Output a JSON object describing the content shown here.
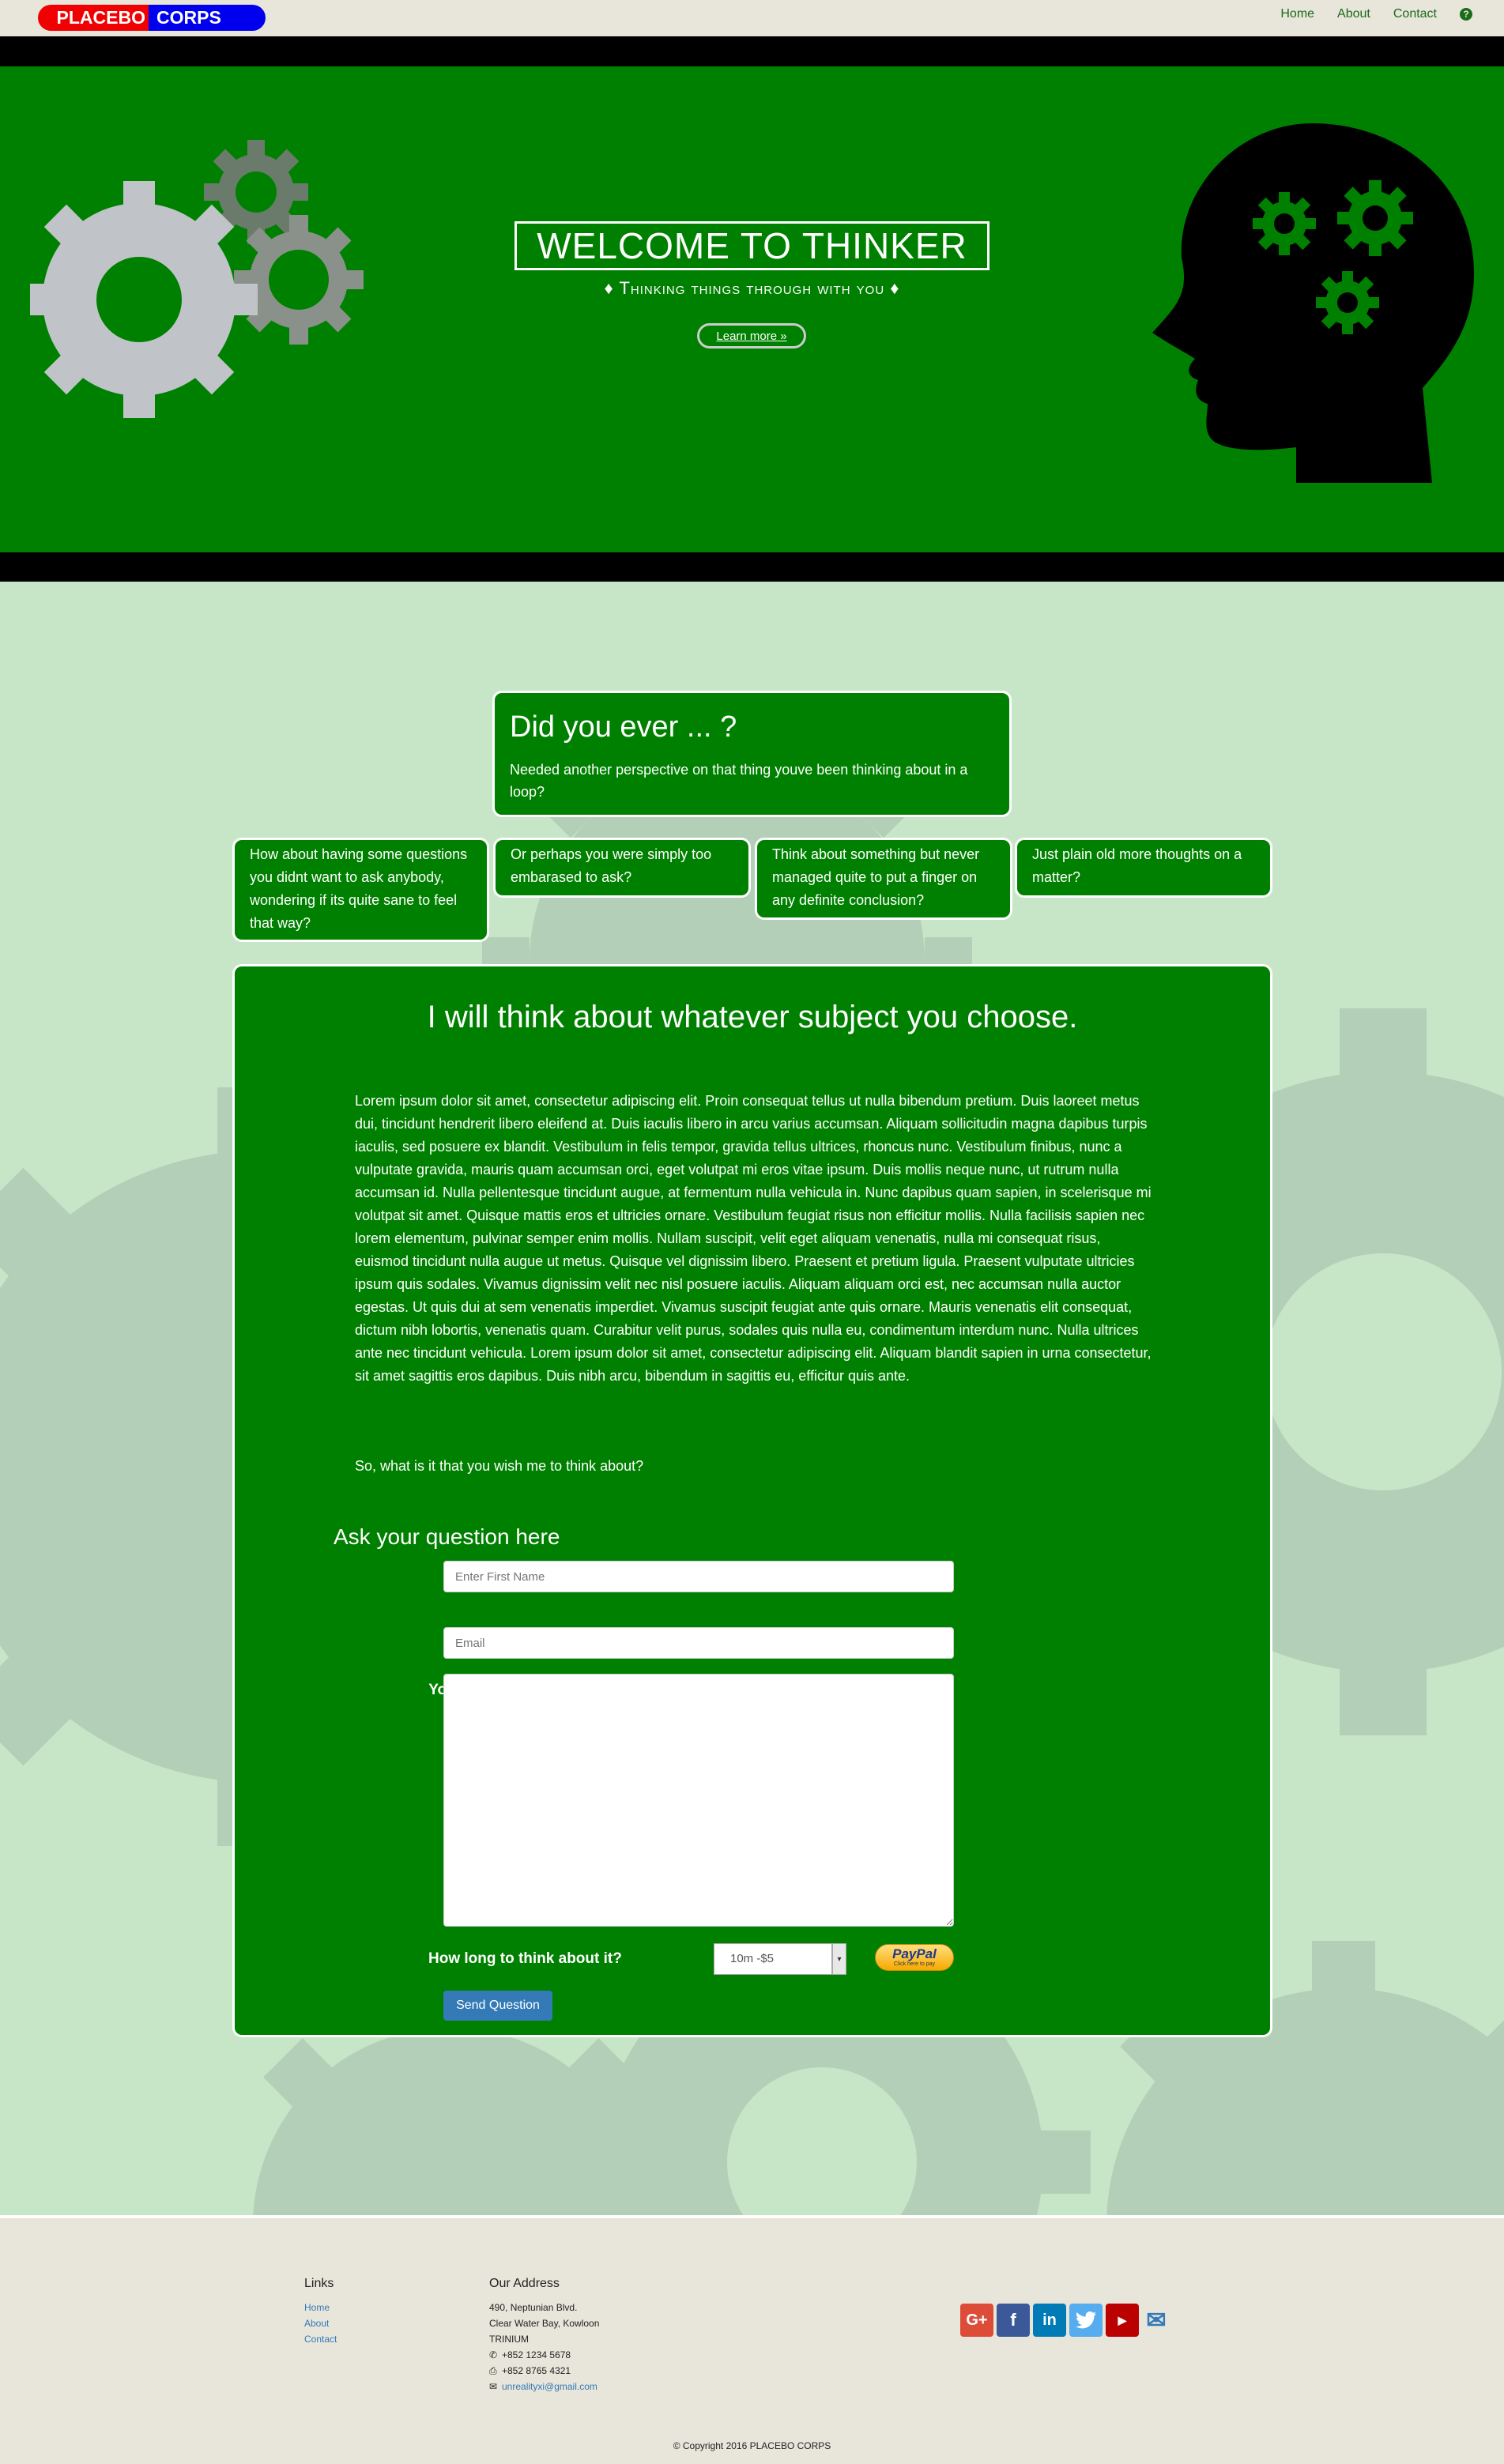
{
  "nav": {
    "brand_part1": "PLACEBO",
    "brand_part2": "CORPS",
    "links": [
      "Home",
      "About",
      "Contact"
    ],
    "help_glyph": "?"
  },
  "hero": {
    "title": "WELCOME TO THINKER",
    "subtitle": "♦ Thinking things through with you ♦",
    "button": "Learn more »"
  },
  "cards": {
    "main_title": "Did you ever ... ?",
    "main_text": "Needed another perspective on that thing youve been thinking about in a loop?",
    "c1": "How about having some questions you didnt want to ask anybody, wondering if its quite sane to feel that way?",
    "c2": "Or perhaps you were simply too embarased to ask?",
    "c3": "Think about something but never managed quite to put a finger on any definite conclusion?",
    "c4": "Just plain old more thoughts on a matter?"
  },
  "main": {
    "title": "I will think about whatever subject you choose.",
    "lorem": "Lorem ipsum dolor sit amet, consectetur adipiscing elit. Proin consequat tellus ut nulla bibendum pretium. Duis laoreet metus dui, tincidunt hendrerit libero eleifend at. Duis iaculis libero in arcu varius accumsan. Aliquam sollicitudin magna dapibus turpis iaculis, sed posuere ex blandit. Vestibulum in felis tempor, gravida tellus ultrices, rhoncus nunc. Vestibulum finibus, nunc a vulputate gravida, mauris quam accumsan orci, eget volutpat mi eros vitae ipsum. Duis mollis neque nunc, ut rutrum nulla accumsan id. Nulla pellentesque tincidunt augue, at fermentum nulla vehicula in. Nunc dapibus quam sapien, in scelerisque mi volutpat sit amet. Quisque mattis eros et ultricies ornare. Vestibulum feugiat risus non efficitur mollis. Nulla facilisis sapien nec lorem elementum, pulvinar semper enim mollis. Nullam suscipit, velit eget aliquam venenatis, nulla mi consequat risus, euismod tincidunt nulla augue ut metus. Quisque vel dignissim libero. Praesent et pretium ligula. Praesent vulputate ultricies ipsum quis sodales. Vivamus dignissim velit nec nisl posuere iaculis. Aliquam aliquam orci est, nec accumsan nulla auctor egestas. Ut quis dui at sem venenatis imperdiet. Vivamus suscipit feugiat ante quis ornare. Mauris venenatis elit consequat, dictum nibh lobortis, venenatis quam. Curabitur velit purus, sodales quis nulla eu, condimentum interdum nunc. Nulla ultrices ante nec tincidunt vehicula. Lorem ipsum dolor sit amet, consectetur adipiscing elit. Aliquam blandit sapien in urna consectetur, sit amet sagittis eros dapibus. Duis nibh arcu, bibendum in sagittis eu, efficitur quis ante.",
    "prompt": "So, what is it that you wish me to think about?"
  },
  "form": {
    "heading": "Ask your question here",
    "first_name_label": "First Name",
    "first_name_placeholder": "Enter First Name",
    "email_label": "Email",
    "email_placeholder": "Email",
    "feedback_label": "Your Feedback",
    "duration_label": "How long to think about it?",
    "duration_value": "10m -$5",
    "paypal_brand": "PayPal",
    "paypal_caption": "Click here to pay",
    "send_button": "Send Question"
  },
  "footer": {
    "links_heading": "Links",
    "links": [
      "Home",
      "About",
      "Contact"
    ],
    "address_heading": "Our Address",
    "address_line1": "490, Neptunian Blvd.",
    "address_line2": "Clear Water Bay, Kowloon",
    "address_line3": "TRINIUM",
    "phone": "+852 1234 5678",
    "fax": "+852 8765 4321",
    "email": "unrealityxi@gmail.com",
    "copyright": "© Copyright 2016 PLACEBO CORPS"
  },
  "colors": {
    "green": "#008000",
    "light_green": "#c7e6c7",
    "nav_bg": "#e8e5da",
    "brand_red": "#f00000",
    "brand_blue": "#0000ee"
  },
  "icons": [
    "google-plus-icon",
    "facebook-icon",
    "linkedin-icon",
    "twitter-icon",
    "youtube-icon",
    "envelope-icon",
    "phone-icon",
    "fax-icon",
    "question-circle-icon"
  ]
}
